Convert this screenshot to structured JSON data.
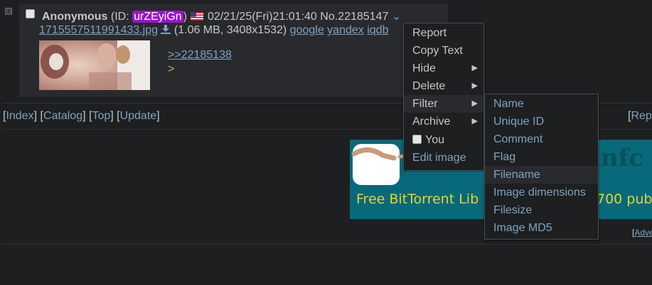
{
  "post": {
    "collapse_glyph": "⊟",
    "name": "Anonymous",
    "id_prefix": "(ID: ",
    "id": "urZEyiGn",
    "id_suffix": ")",
    "datetime": "02/21/25(Fri)21:01:40",
    "number": "No.22185147",
    "chevron": "⌄",
    "filename": "1715557511991433.jpg",
    "fileinfo": "(1.06 MB, 3408x1532)",
    "search_links": [
      "google",
      "yandex",
      "iqdb"
    ],
    "quote": ">>22185138",
    "greentext": ">"
  },
  "nav": {
    "links": [
      "Index",
      "Catalog",
      "Top",
      "Update"
    ],
    "right": "Rep"
  },
  "banner": {
    "text": "Free BitTorrent Lib",
    "text_right": "700 pub",
    "title_fragment": "infc"
  },
  "advert": "Adve",
  "context_menu": {
    "items": [
      {
        "label": "Report",
        "submenu": false
      },
      {
        "label": "Copy Text",
        "submenu": false
      },
      {
        "label": "Hide",
        "submenu": true
      },
      {
        "label": "Delete",
        "submenu": true
      },
      {
        "label": "Filter",
        "submenu": true,
        "active": true
      },
      {
        "label": "Archive",
        "submenu": true
      },
      {
        "label": "You",
        "checkbox": true
      },
      {
        "label": "Edit image",
        "submenu": false
      }
    ],
    "arrow": "▶"
  },
  "filter_submenu": {
    "items": [
      "Name",
      "Unique ID",
      "Comment",
      "Flag",
      "Filename",
      "Image dimensions",
      "Filesize",
      "Image MD5"
    ],
    "highlighted": "Filename"
  },
  "colors": {
    "id_badge": "#9b12d0",
    "link": "#81a2be",
    "greentext": "#b5bd68",
    "bg": "#1d1f21",
    "post_bg": "#282a2e"
  }
}
